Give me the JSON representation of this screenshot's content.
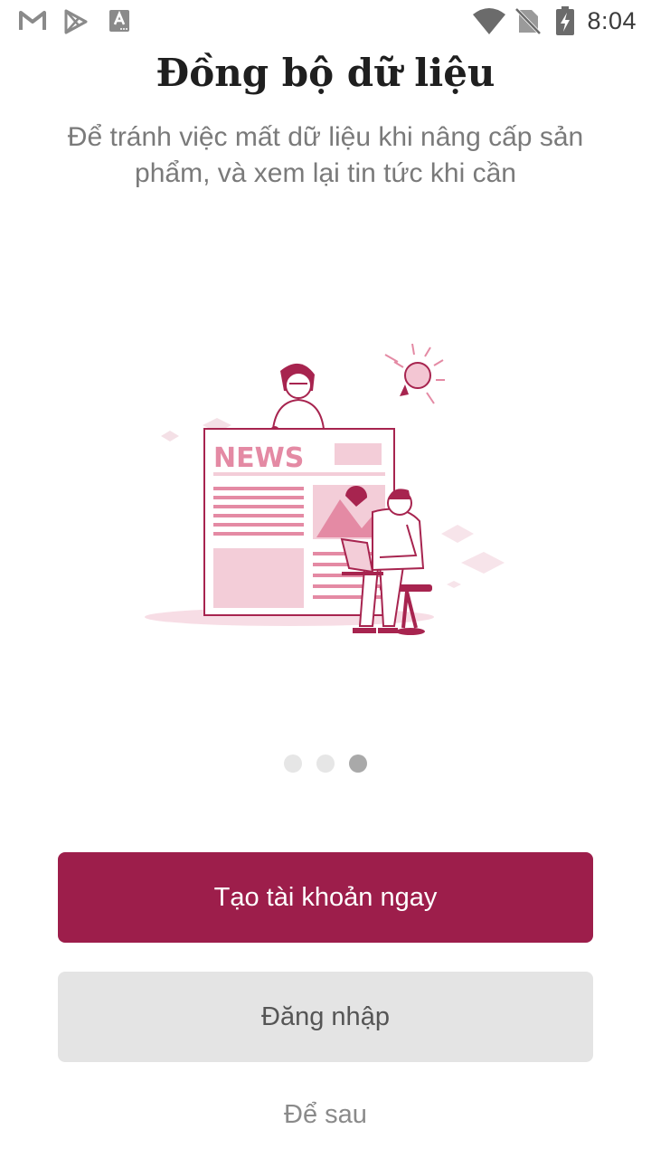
{
  "status_bar": {
    "time": "8:04",
    "left_icons": [
      "gmail-icon",
      "play-store-icon",
      "font-a-icon"
    ],
    "right_icons": [
      "wifi-icon",
      "no-sim-icon",
      "battery-charging-icon"
    ]
  },
  "onboarding": {
    "title": "Đồng bộ dữ liệu",
    "subtitle": "Để tránh việc mất dữ liệu khi nâng cấp sản phẩm, và xem lại tin tức khi cần",
    "illustration": {
      "news_label": "NEWS",
      "icon": "newspaper-illustration"
    },
    "page_indicator": {
      "total": 3,
      "current": 3
    }
  },
  "actions": {
    "create_account": "Tạo tài khoản ngay",
    "login": "Đăng nhập",
    "later": "Để sau"
  },
  "colors": {
    "primary": "#9d1e4b",
    "secondary_bg": "#e4e4e4",
    "illustration_pink": "#e48aa4",
    "illustration_light": "#f7dde5"
  }
}
